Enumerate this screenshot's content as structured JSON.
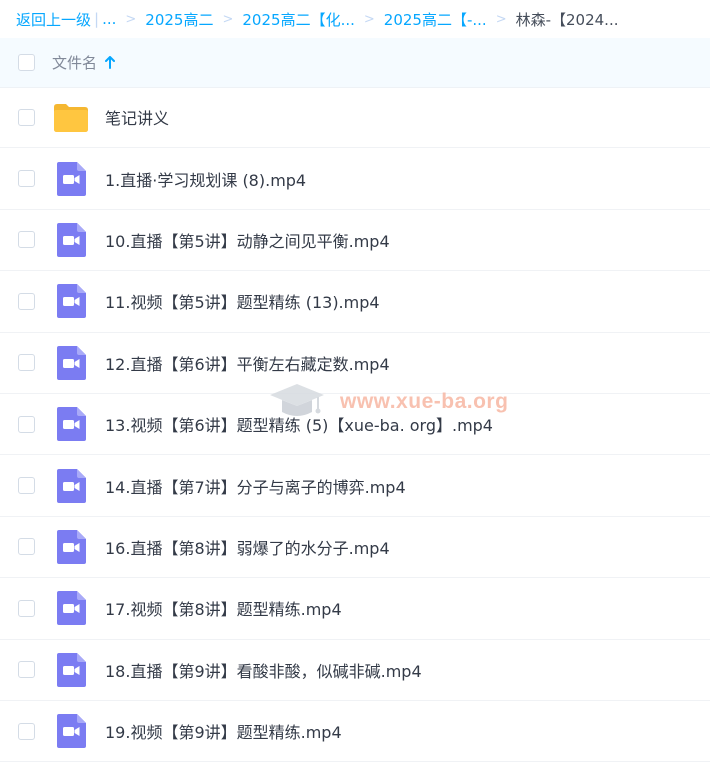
{
  "breadcrumb": {
    "back": "返回上一级",
    "ellipsis": "...",
    "items": [
      "2025高二",
      "2025高二【化...",
      "2025高二【-..."
    ],
    "current": "林森-【2024..."
  },
  "header": {
    "column_name": "文件名"
  },
  "watermark": {
    "text": "www.xue-ba.org"
  },
  "files": [
    {
      "name": "笔记讲义",
      "icon": "folder-icon"
    },
    {
      "name": "1.直播·学习规划课 (8).mp4",
      "icon": "video-file-icon"
    },
    {
      "name": "10.直播【第5讲】动静之间见平衡.mp4",
      "icon": "video-file-icon"
    },
    {
      "name": "11.视频【第5讲】题型精练 (13).mp4",
      "icon": "video-file-icon"
    },
    {
      "name": "12.直播【第6讲】平衡左右藏定数.mp4",
      "icon": "video-file-icon"
    },
    {
      "name": "13.视频【第6讲】题型精练 (5)【xue-ba. org】.mp4",
      "icon": "video-file-icon"
    },
    {
      "name": "14.直播【第7讲】分子与离子的博弈.mp4",
      "icon": "video-file-icon"
    },
    {
      "name": "16.直播【第8讲】弱爆了的水分子.mp4",
      "icon": "video-file-icon"
    },
    {
      "name": "17.视频【第8讲】题型精练.mp4",
      "icon": "video-file-icon"
    },
    {
      "name": "18.直播【第9讲】看酸非酸，似碱非碱.mp4",
      "icon": "video-file-icon"
    },
    {
      "name": "19.视频【第9讲】题型精练.mp4",
      "icon": "video-file-icon"
    }
  ],
  "colors": {
    "accent": "#06a7ff",
    "video_icon": "#7b7cf2",
    "folder_icon": "#ffc640",
    "header_bg": "#f5fbff"
  }
}
